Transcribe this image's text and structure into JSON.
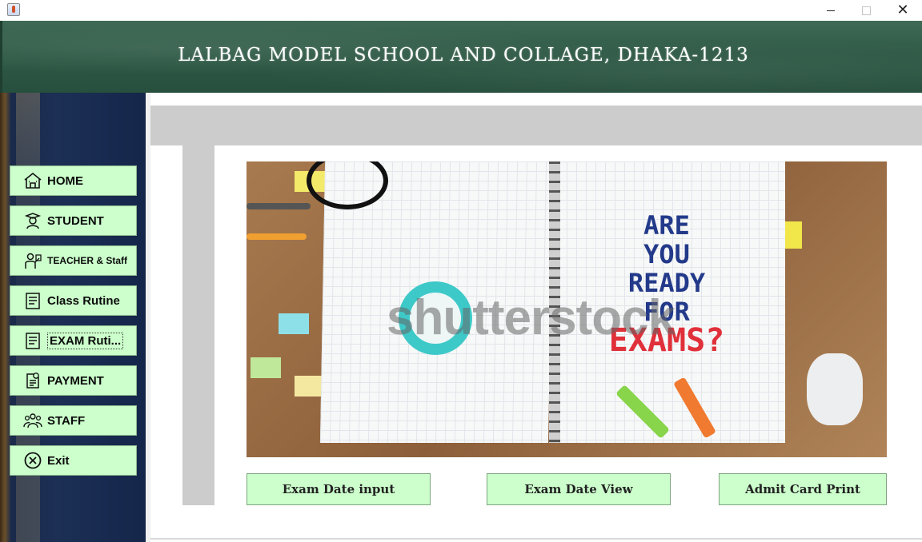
{
  "window": {
    "minimize_glyph": "—",
    "maximize_glyph": "☐",
    "close_glyph": "✕"
  },
  "header": {
    "title": "LALBAG MODEL SCHOOL AND COLLAGE, DHAKA-1213"
  },
  "sidebar": {
    "items": [
      {
        "label": "HOME",
        "icon": "school-building-icon"
      },
      {
        "label": "STUDENT",
        "icon": "graduate-icon"
      },
      {
        "label": "TEACHER & Staff",
        "icon": "teacher-icon"
      },
      {
        "label": "Class Rutine",
        "icon": "schedule-list-icon"
      },
      {
        "label": "EXAM Ruti...",
        "icon": "exam-list-icon"
      },
      {
        "label": "PAYMENT",
        "icon": "invoice-icon"
      },
      {
        "label": "STAFF",
        "icon": "group-icon"
      },
      {
        "label": "Exit",
        "icon": "close-circle-icon"
      }
    ]
  },
  "hero": {
    "text_lines": [
      "ARE",
      "YOU",
      "READY",
      "FOR",
      "EXAMS?"
    ],
    "watermark": "shutterstock"
  },
  "actions": {
    "exam_date_input": "Exam Date input",
    "exam_date_view": "Exam Date View",
    "admit_card_print": "Admit Card Print"
  },
  "colors": {
    "button_bg": "#ccffcc",
    "header_green": "#2f5a46",
    "sidebar_navy": "#1c2f55",
    "panel_gray": "#cccccc"
  }
}
